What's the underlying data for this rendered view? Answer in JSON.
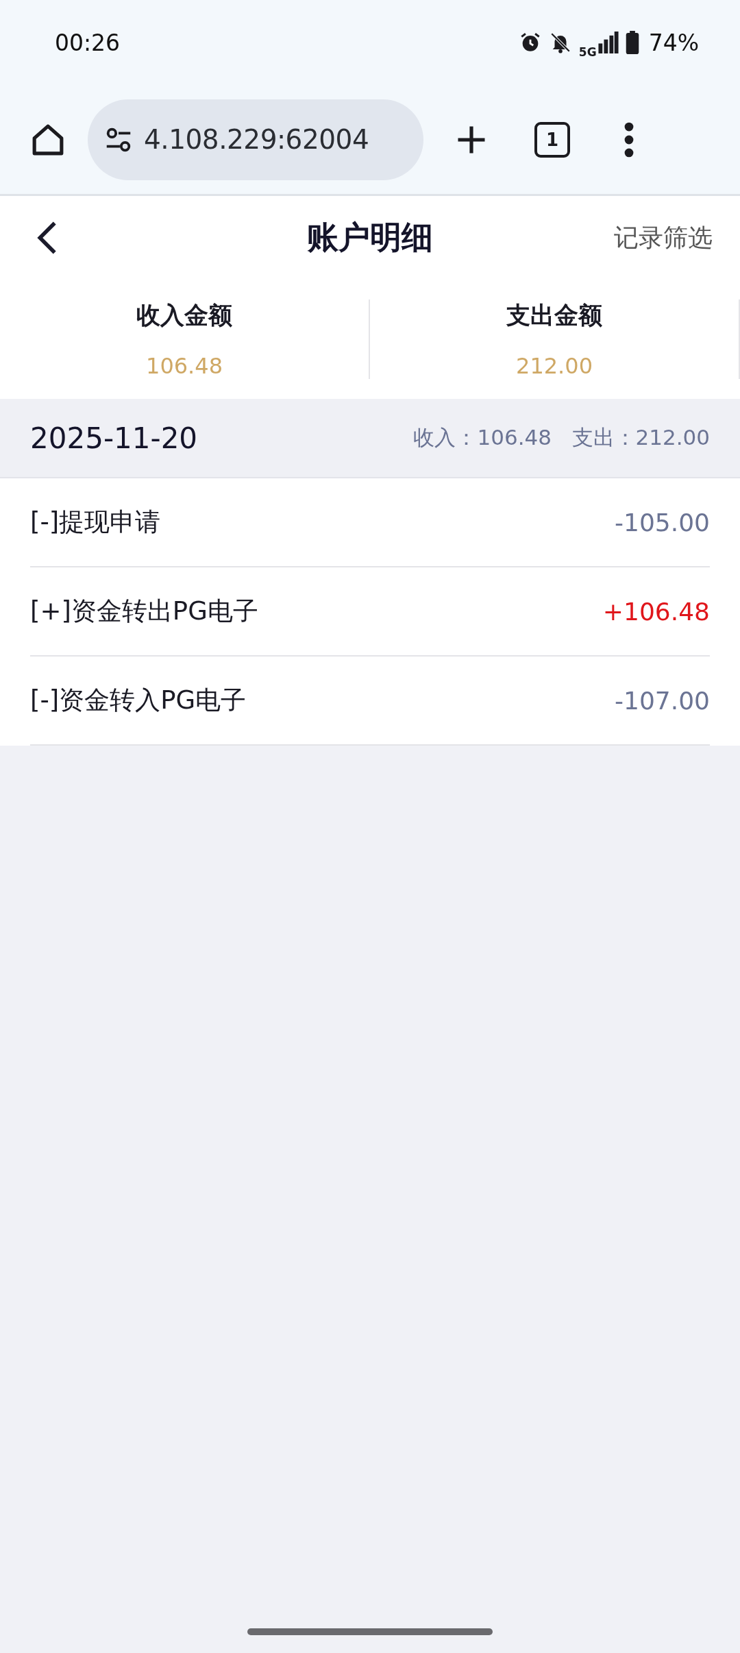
{
  "status_bar": {
    "time": "00:26",
    "network": "5G",
    "battery": "74%"
  },
  "browser": {
    "url": "4.108.229:62004",
    "tab_count": "1"
  },
  "header": {
    "title": "账户明细",
    "action": "记录筛选"
  },
  "summary": [
    {
      "label": "收入金额",
      "value": "106.48"
    },
    {
      "label": "支出金额",
      "value": "212.00"
    }
  ],
  "day": {
    "date": "2025-11-20",
    "totals": "收入：106.48   支出：212.00"
  },
  "records": [
    {
      "title": "[-]提现申请",
      "amount": "-105.00",
      "kind": "expense"
    },
    {
      "title": "[+]资金转出PG电子",
      "amount": "+106.48",
      "kind": "income"
    },
    {
      "title": "[-]资金转入PG电子",
      "amount": "-107.00",
      "kind": "expense"
    }
  ]
}
